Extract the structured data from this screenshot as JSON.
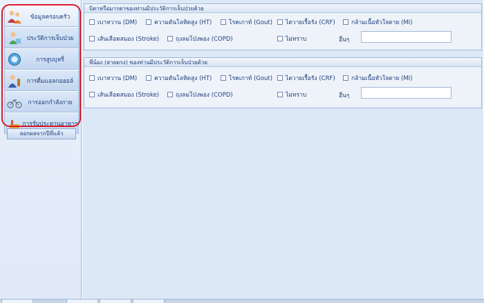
{
  "sidebar": {
    "items": [
      {
        "label": "ข้อมูลครอบครัว",
        "icon": "family-icon"
      },
      {
        "label": "ประวัติการเจ็บป่วย",
        "icon": "patient-icon"
      },
      {
        "label": "การสูบบุหรี่",
        "icon": "smoking-icon"
      },
      {
        "label": "การดื่มแอลกอฮอล์",
        "icon": "alcohol-icon"
      },
      {
        "label": "การออกกำลังกาย",
        "icon": "bicycle-icon"
      },
      {
        "label": "การรับประทานอาหาร",
        "icon": "food-icon"
      }
    ],
    "copy_button": "ลอกผลจากปีที่แล้ว"
  },
  "parents": {
    "title": "บิดาหรือมารดาของท่านมีประวัติการเจ็บป่วยด้วย",
    "row1": [
      "เบาหวาน (DM)",
      "ความดันโลหิตสูง (HT)",
      "โรคเกาท์ (Gout)",
      "ไตวายเรื้อรัง (CRF)",
      "กล้ามเนื้อหัวใจตาย (MI)"
    ],
    "row2": [
      "เส้นเลือดสมอง (Stroke)",
      "ถุงลมโป่งพอง (COPD)",
      "ไม่ทราบ"
    ],
    "other_label": "อื่นๆ",
    "other_value": ""
  },
  "siblings": {
    "title": "พี่น้อง (สายตรง) ของท่านมีประวัติการเจ็บป่วยด้วย",
    "row1": [
      "เบาหวาน (DM)",
      "ความดันโลหิตสูง (HT)",
      "โรคเกาท์ (Gout)",
      "ไตวายเรื้อรัง (CRF)",
      "กล้ามเนื้อหัวใจตาย (MI)"
    ],
    "row2": [
      "เส้นเลือดสมอง (Stroke)",
      "ถุงลมโป่งพอง (COPD)",
      "ไม่ทราบ"
    ],
    "other_label": "อื่นๆ",
    "other_value": ""
  },
  "colors": {
    "highlight": "#d9182a",
    "accent": "#1f3f7a",
    "panel": "#dde8f6"
  }
}
